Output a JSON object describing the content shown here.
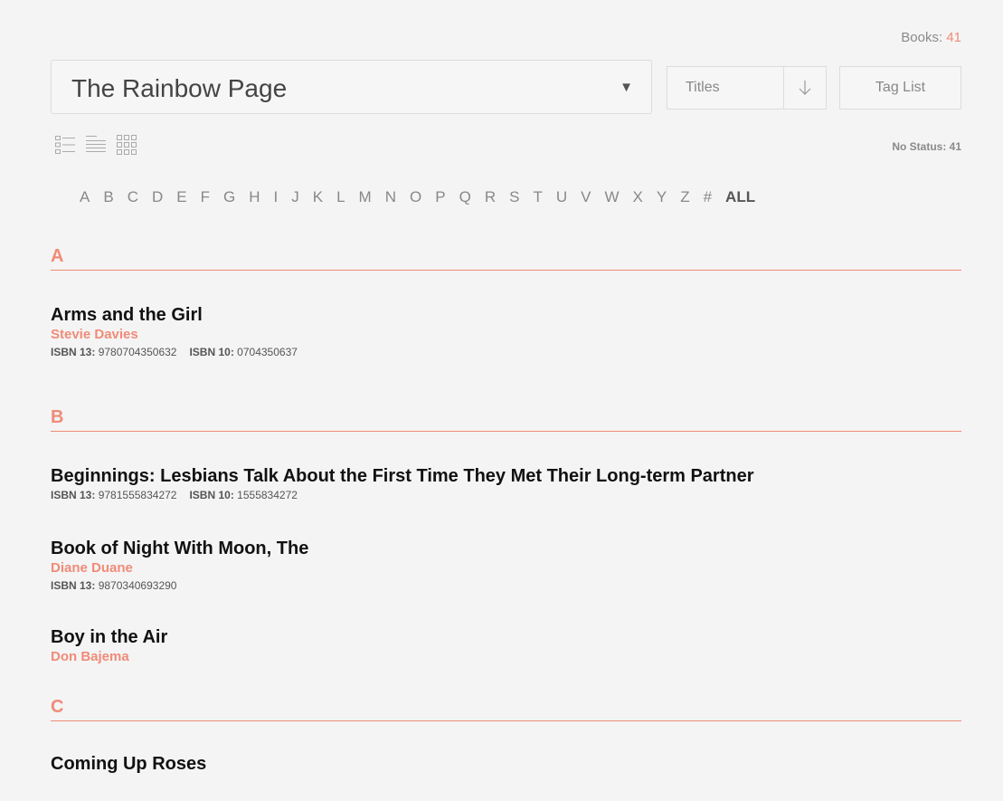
{
  "header": {
    "books_label": "Books:",
    "books_count": "41",
    "shelf_name": "The Rainbow Page",
    "shelf_caret": "▼",
    "sort_label": "Titles",
    "sort_direction": "↓",
    "tag_list_label": "Tag List",
    "no_status": "No Status: 41"
  },
  "view_icons": [
    "detail-list-icon",
    "compact-list-icon",
    "grid-icon"
  ],
  "alphabet": [
    "A",
    "B",
    "C",
    "D",
    "E",
    "F",
    "G",
    "H",
    "I",
    "J",
    "K",
    "L",
    "M",
    "N",
    "O",
    "P",
    "Q",
    "R",
    "S",
    "T",
    "U",
    "V",
    "W",
    "X",
    "Y",
    "Z",
    "#"
  ],
  "alphabet_all": "ALL",
  "isbn13_label": "ISBN 13:",
  "isbn10_label": "ISBN 10:",
  "sections": [
    {
      "letter": "A",
      "books": [
        {
          "title": "Arms and the Girl",
          "author": "Stevie Davies",
          "isbn13": "9780704350632",
          "isbn10": "0704350637"
        }
      ]
    },
    {
      "letter": "B",
      "books": [
        {
          "title": "Beginnings: Lesbians Talk About the First Time They Met Their Long-term Partner",
          "author": "",
          "isbn13": "9781555834272",
          "isbn10": "1555834272"
        },
        {
          "title": "Book of Night With Moon, The",
          "author": "Diane Duane",
          "isbn13": "9870340693290",
          "isbn10": ""
        },
        {
          "title": "Boy in the Air",
          "author": "Don Bajema",
          "isbn13": "",
          "isbn10": ""
        }
      ]
    },
    {
      "letter": "C",
      "books": [
        {
          "title": "Coming Up Roses",
          "author": "",
          "isbn13": "",
          "isbn10": ""
        }
      ]
    }
  ],
  "colors": {
    "accent": "#f08b78",
    "background": "#f4f4f4"
  }
}
